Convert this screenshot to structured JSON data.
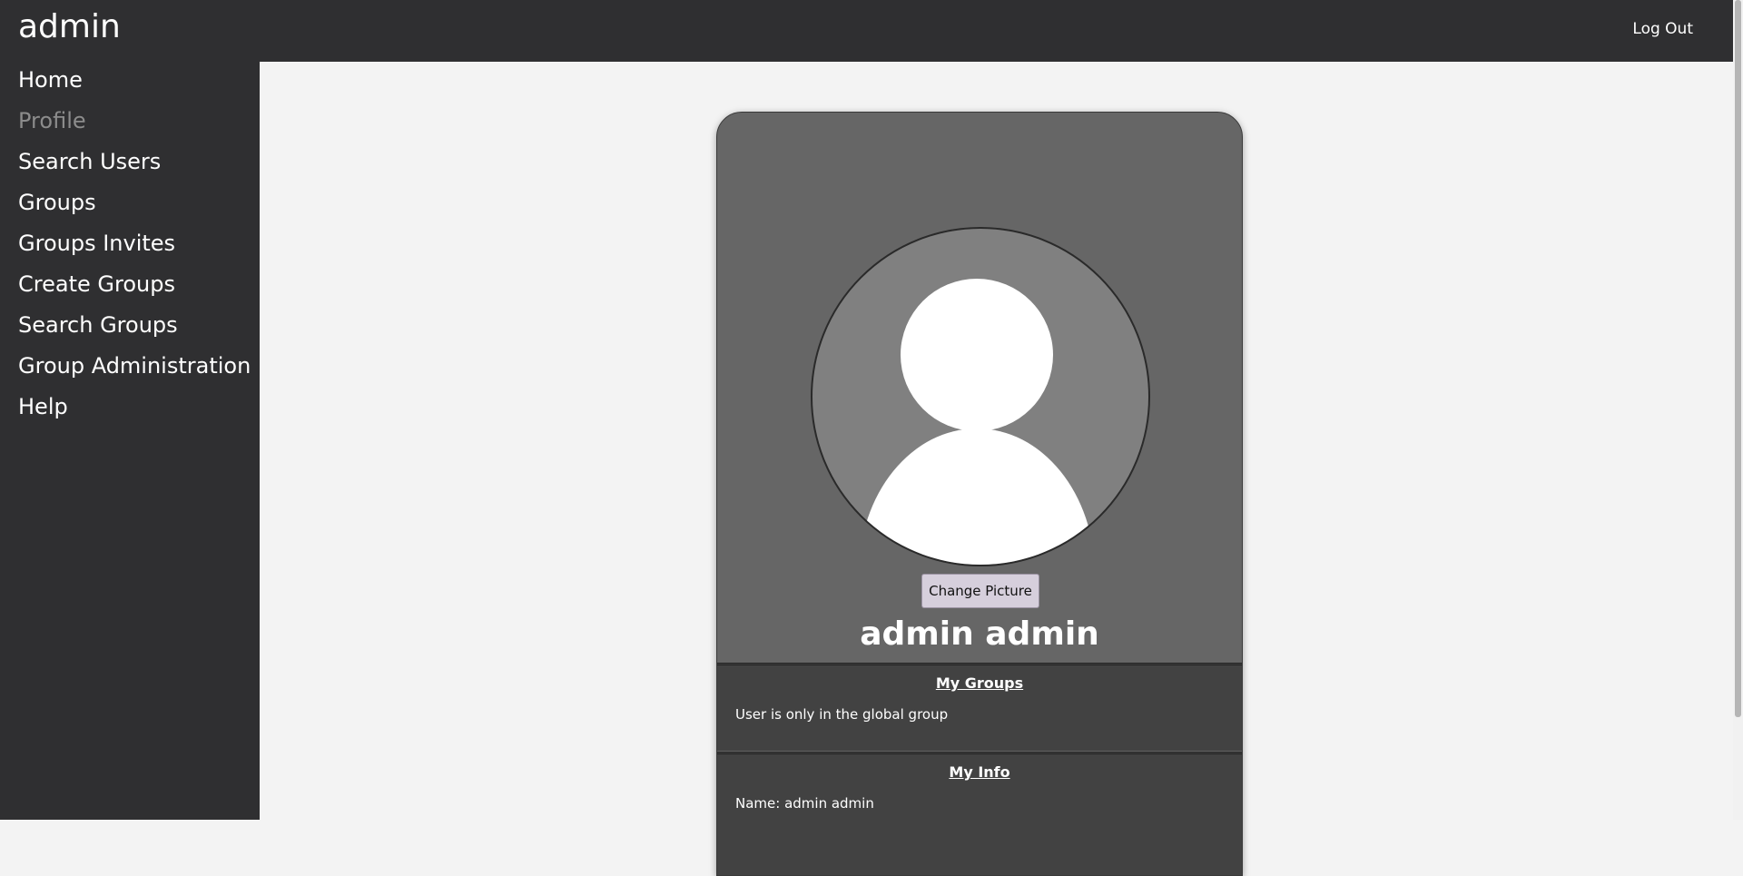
{
  "header": {
    "app_title": "admin",
    "logout_label": "Log Out"
  },
  "sidebar": {
    "items": [
      {
        "label": "Home",
        "active": false
      },
      {
        "label": "Profile",
        "active": true
      },
      {
        "label": "Search Users",
        "active": false
      },
      {
        "label": "Groups",
        "active": false
      },
      {
        "label": "Groups Invites",
        "active": false
      },
      {
        "label": "Create Groups",
        "active": false
      },
      {
        "label": "Search Groups",
        "active": false
      },
      {
        "label": "Group Administration",
        "active": false
      },
      {
        "label": "Help",
        "active": false
      }
    ]
  },
  "profile": {
    "avatar_icon": "default-user-icon",
    "change_picture_label": "Change Picture",
    "name": "admin admin",
    "groups": {
      "title": "My Groups",
      "text": "User is only in the global group"
    },
    "info": {
      "title": "My Info",
      "name_line": "Name: admin admin"
    }
  },
  "colors": {
    "bar_background": "#2f2f31",
    "main_background": "#f3f3f3",
    "card_background": "#666666",
    "section_background": "#424242",
    "active_nav": "#8c8c8c"
  }
}
